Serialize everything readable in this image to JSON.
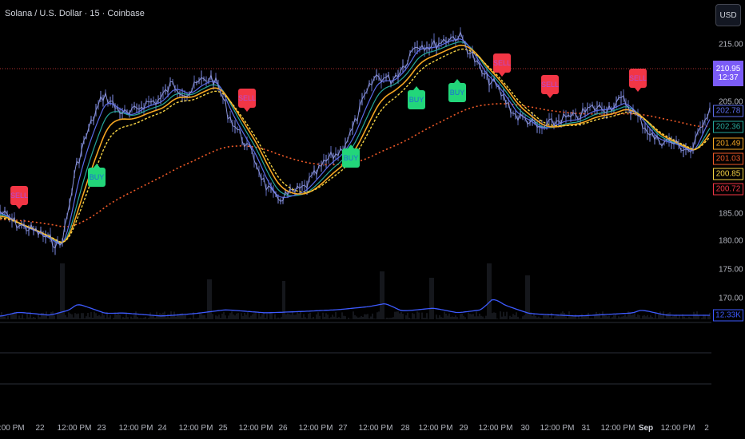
{
  "header": {
    "title": "Solana / U.S. Dollar · 15 · Coinbase",
    "currency_button": "USD"
  },
  "price_scale": {
    "ticks": [
      "215.00",
      "205.00",
      "185.00",
      "180.00",
      "175.00",
      "170.00"
    ],
    "last_price": "210.95",
    "countdown": "12:37",
    "tags": [
      {
        "label": "202.78",
        "color": "#5b6be8"
      },
      {
        "label": "202.36",
        "color": "#26a69a"
      },
      {
        "label": "201.49",
        "color": "#f5a623"
      },
      {
        "label": "201.03",
        "color": "#f05a28"
      },
      {
        "label": "200.85",
        "color": "#f5d142"
      },
      {
        "label": "200.72",
        "color": "#f23645"
      },
      {
        "label": "12.33K",
        "color": "#3d5afe"
      }
    ]
  },
  "time_scale": {
    "labels": [
      {
        "text": "2:00 PM",
        "bold": false
      },
      {
        "text": "22",
        "bold": false
      },
      {
        "text": "12:00 PM",
        "bold": false
      },
      {
        "text": "23",
        "bold": false
      },
      {
        "text": "12:00 PM",
        "bold": false
      },
      {
        "text": "24",
        "bold": false
      },
      {
        "text": "12:00 PM",
        "bold": false
      },
      {
        "text": "25",
        "bold": false
      },
      {
        "text": "12:00 PM",
        "bold": false
      },
      {
        "text": "26",
        "bold": false
      },
      {
        "text": "12:00 PM",
        "bold": false
      },
      {
        "text": "27",
        "bold": false
      },
      {
        "text": "12:00 PM",
        "bold": false
      },
      {
        "text": "28",
        "bold": false
      },
      {
        "text": "12:00 PM",
        "bold": false
      },
      {
        "text": "29",
        "bold": false
      },
      {
        "text": "12:00 PM",
        "bold": false
      },
      {
        "text": "30",
        "bold": false
      },
      {
        "text": "12:00 PM",
        "bold": false
      },
      {
        "text": "31",
        "bold": false
      },
      {
        "text": "12:00 PM",
        "bold": false
      },
      {
        "text": "Sep",
        "bold": true
      },
      {
        "text": "12:00 PM",
        "bold": false
      },
      {
        "text": "2",
        "bold": false
      }
    ]
  },
  "signals": [
    {
      "type": "sell",
      "label": "SELL"
    },
    {
      "type": "buy",
      "label": "BUY"
    },
    {
      "type": "sell",
      "label": "SELL"
    },
    {
      "type": "buy",
      "label": "BUY"
    },
    {
      "type": "buy",
      "label": "BUY"
    },
    {
      "type": "buy",
      "label": "BUY"
    },
    {
      "type": "sell",
      "label": "SELL"
    },
    {
      "type": "sell",
      "label": "SELL"
    },
    {
      "type": "sell",
      "label": "SELL"
    }
  ],
  "colors": {
    "background": "#000000",
    "price_line": "#8a93d8",
    "volume_line": "#3d5afe",
    "resistance_line": "#b03030",
    "last_price_bg": "#7b5cf6"
  }
}
